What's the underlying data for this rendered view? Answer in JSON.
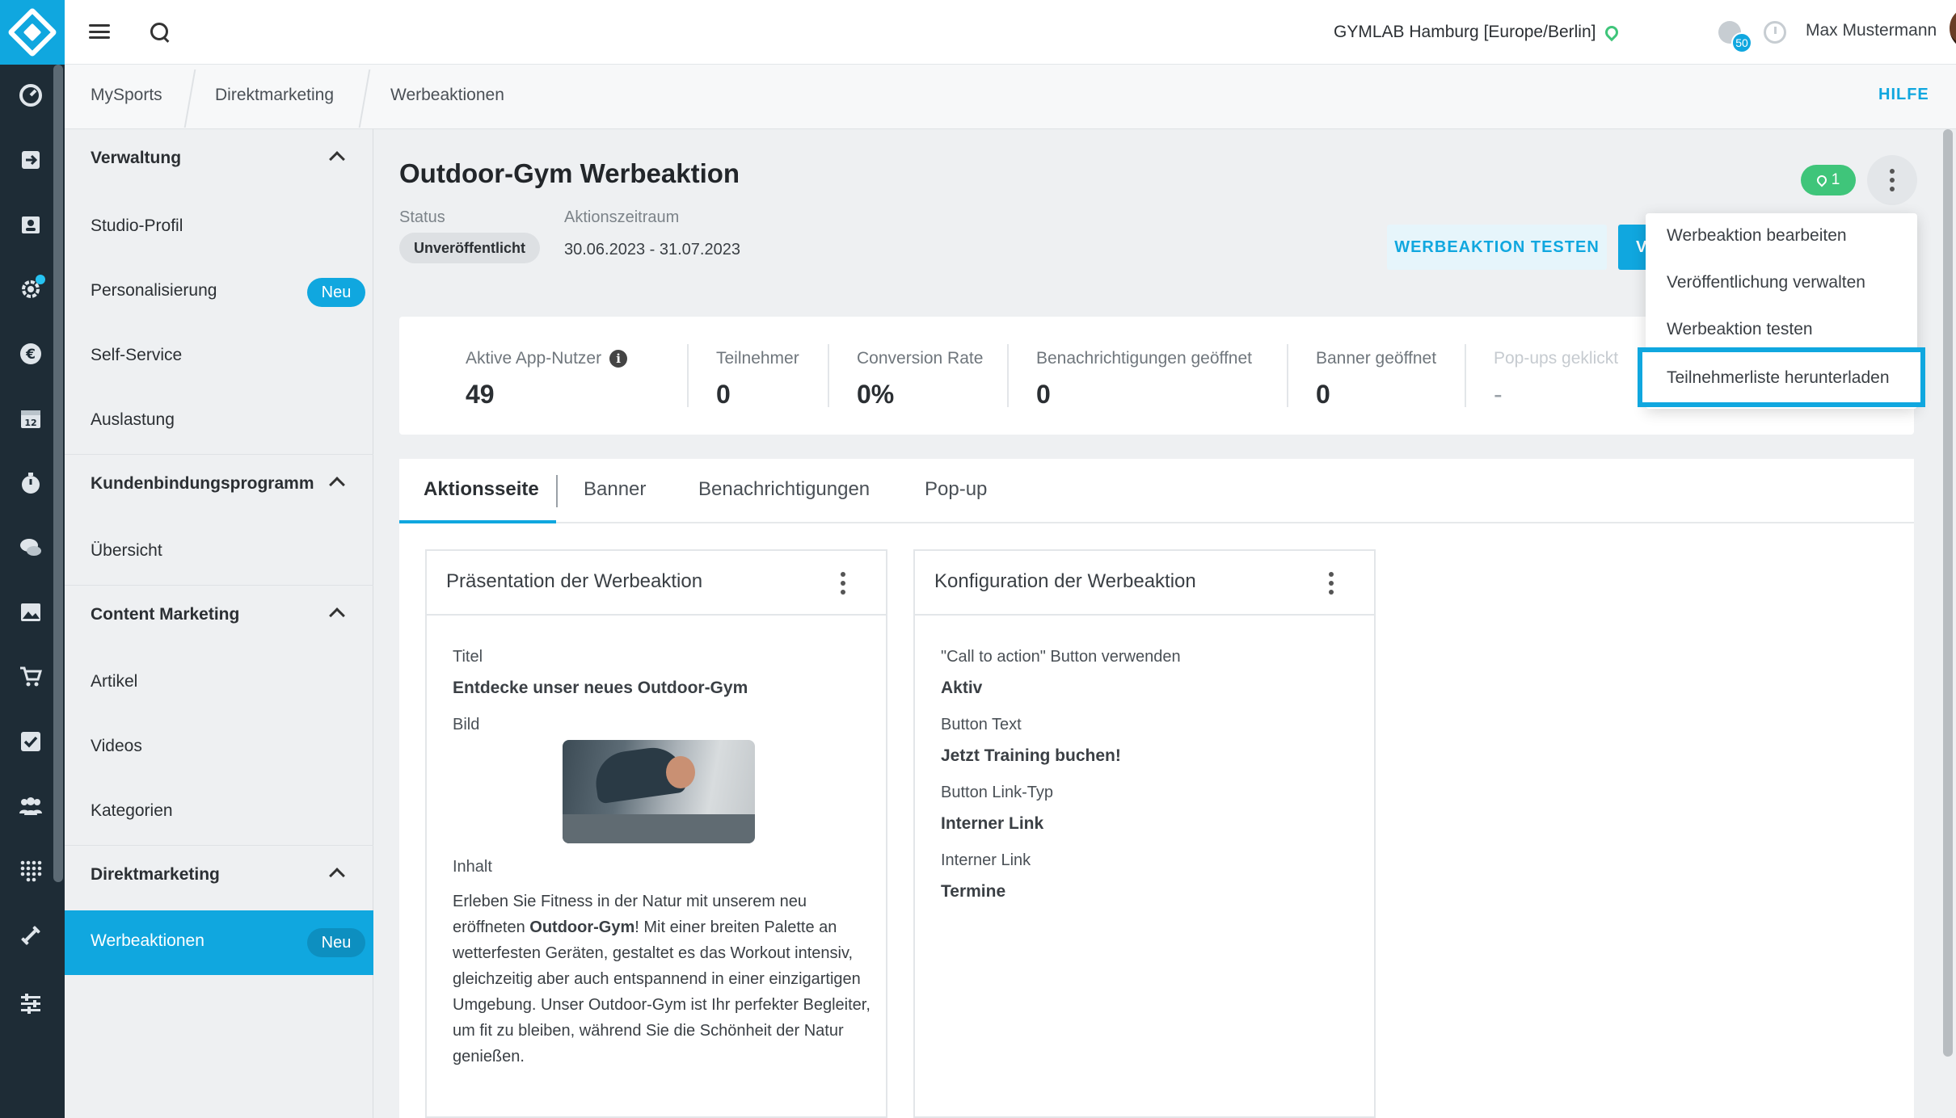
{
  "rail": {
    "icons": [
      "dashboard-icon",
      "login-icon",
      "contacts-icon",
      "settings-cog-icon",
      "euro-icon",
      "calendar-icon",
      "stopwatch-icon",
      "chat-icon",
      "image-icon",
      "cart-icon",
      "checkbox-icon",
      "group-icon",
      "grid-dots-icon",
      "dumbbell-icon",
      "sliders-icon"
    ],
    "calendar_day": "12"
  },
  "topbar": {
    "studio": "GYMLAB Hamburg [Europe/Berlin]",
    "notification_count": "50",
    "username": "Max Mustermann"
  },
  "breadcrumb": {
    "items": [
      "MySports",
      "Direktmarketing",
      "Werbeaktionen"
    ],
    "help": "HILFE"
  },
  "sidebar": {
    "sections": [
      {
        "title": "Verwaltung",
        "items": [
          {
            "label": "Studio-Profil"
          },
          {
            "label": "Personalisierung",
            "badge": "Neu"
          },
          {
            "label": "Self-Service"
          },
          {
            "label": "Auslastung"
          }
        ]
      },
      {
        "title": "Kundenbindungsprogramm",
        "items": [
          {
            "label": "Übersicht"
          }
        ]
      },
      {
        "title": "Content Marketing",
        "items": [
          {
            "label": "Artikel"
          },
          {
            "label": "Videos"
          },
          {
            "label": "Kategorien"
          }
        ]
      },
      {
        "title": "Direktmarketing",
        "items": [
          {
            "label": "Werbeaktionen",
            "badge": "Neu",
            "active": true
          }
        ]
      }
    ]
  },
  "campaign": {
    "title": "Outdoor-Gym Werbeaktion",
    "status_label": "Status",
    "status": "Unveröffentlicht",
    "period_label": "Aktionszeitraum",
    "period": "30.06.2023 - 31.07.2023",
    "test_button": "WERBEAKTION TESTEN",
    "publish_button_partial": "V",
    "location_count": "1"
  },
  "stats": [
    {
      "label": "Aktive App-Nutzer",
      "value": "49",
      "info": "i"
    },
    {
      "label": "Teilnehmer",
      "value": "0"
    },
    {
      "label": "Conversion Rate",
      "value": "0%"
    },
    {
      "label": "Benachrichtigungen geöffnet",
      "value": "0"
    },
    {
      "label": "Banner geöffnet",
      "value": "0"
    },
    {
      "label": "Pop-ups geklickt",
      "value": "-"
    }
  ],
  "tabs": [
    "Aktionsseite",
    "Banner",
    "Benachrichtigungen",
    "Pop-up"
  ],
  "presentation": {
    "title": "Präsentation der Werbeaktion",
    "title_label": "Titel",
    "title_value": "Entdecke unser neues Outdoor-Gym",
    "image_label": "Bild",
    "content_label": "Inhalt",
    "content_before": "Erleben Sie Fitness in der Natur mit unserem neu eröffneten ",
    "content_bold": "Outdoor-Gym",
    "content_after": "! Mit einer breiten Palette an wetterfesten Geräten, gestaltet es das Workout intensiv, gleichzeitig aber auch entspannend in einer einzigartigen Umgebung. Unser Outdoor-Gym ist Ihr perfekter Begleiter, um fit zu bleiben, während Sie die Schönheit der Natur genießen."
  },
  "configuration": {
    "title": "Konfiguration der Werbeaktion",
    "fields": [
      {
        "label": "\"Call to action\" Button verwenden",
        "value": "Aktiv"
      },
      {
        "label": "Button Text",
        "value": "Jetzt Training buchen!"
      },
      {
        "label": "Button Link-Typ",
        "value": "Interner Link"
      },
      {
        "label": "Interner Link",
        "value": "Termine"
      }
    ]
  },
  "dropdown": {
    "items": [
      "Werbeaktion bearbeiten",
      "Veröffentlichung verwalten",
      "Werbeaktion testen",
      "Teilnehmerliste herunterladen"
    ]
  },
  "colors": {
    "accent": "#10a7df",
    "rail": "#1e2c36",
    "success": "#3fc57a"
  }
}
